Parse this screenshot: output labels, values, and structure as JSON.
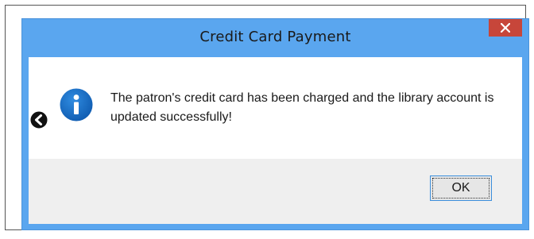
{
  "dialog": {
    "title": "Credit Card Payment",
    "close_icon": "close-icon",
    "close_color": "#c7463a",
    "titlebar_color": "#5aa6ef"
  },
  "message": {
    "icon": "info-icon",
    "icon_color": "#1565c0",
    "text": "The patron's credit card has been charged and the library account is updated successfully!"
  },
  "buttons": {
    "ok_label": "OK"
  },
  "callout": {
    "icon": "back-arrow-callout-icon"
  }
}
